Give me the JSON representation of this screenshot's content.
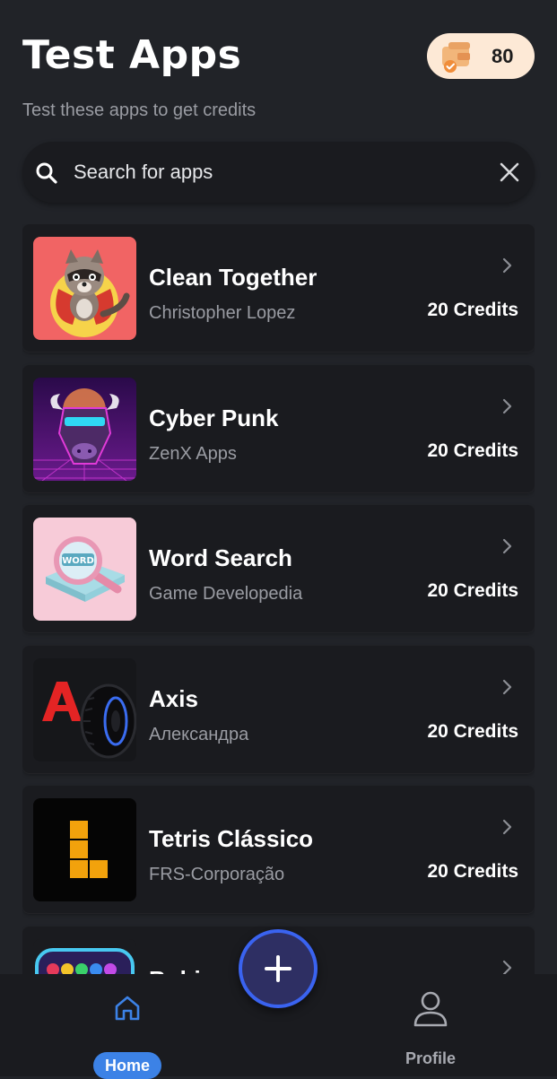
{
  "header": {
    "title": "Test Apps",
    "subtitle": "Test these apps to get credits",
    "credits_balance": "80",
    "credits_icon": "wallet-icon"
  },
  "search": {
    "placeholder": "Search for apps",
    "search_icon": "search-icon",
    "clear_icon": "close-icon"
  },
  "apps": [
    {
      "name": "Clean Together",
      "developer": "Christopher Lopez",
      "credits": "20 Credits",
      "icon": "raccoon-hero-icon"
    },
    {
      "name": "Cyber Punk",
      "developer": "ZenX Apps",
      "credits": "20 Credits",
      "icon": "cyber-bull-icon"
    },
    {
      "name": "Word Search",
      "developer": "Game Developedia",
      "credits": "20 Credits",
      "icon": "magnifier-word-icon"
    },
    {
      "name": "Axis",
      "developer": "Александра",
      "credits": "20 Credits",
      "icon": "tire-letter-a-icon"
    },
    {
      "name": "Tetris Clássico",
      "developer": "FRS-Corporação",
      "credits": "20 Credits",
      "icon": "tetris-l-block-icon"
    },
    {
      "name": "Bubi",
      "developer": "",
      "credits": "",
      "icon": "bubble-shooter-icon"
    }
  ],
  "bottom_nav": {
    "home_label": "Home",
    "profile_label": "Profile",
    "home_icon": "home-icon",
    "profile_icon": "user-icon",
    "fab_icon": "plus-icon"
  },
  "colors": {
    "background": "#212328",
    "card": "#1a1b1f",
    "accent_blue": "#3c82e6",
    "fab_fill": "#2e2f63",
    "fab_ring": "#3a63f0",
    "credits_pill": "#fde9d6",
    "muted_text": "#9a9ca3"
  }
}
